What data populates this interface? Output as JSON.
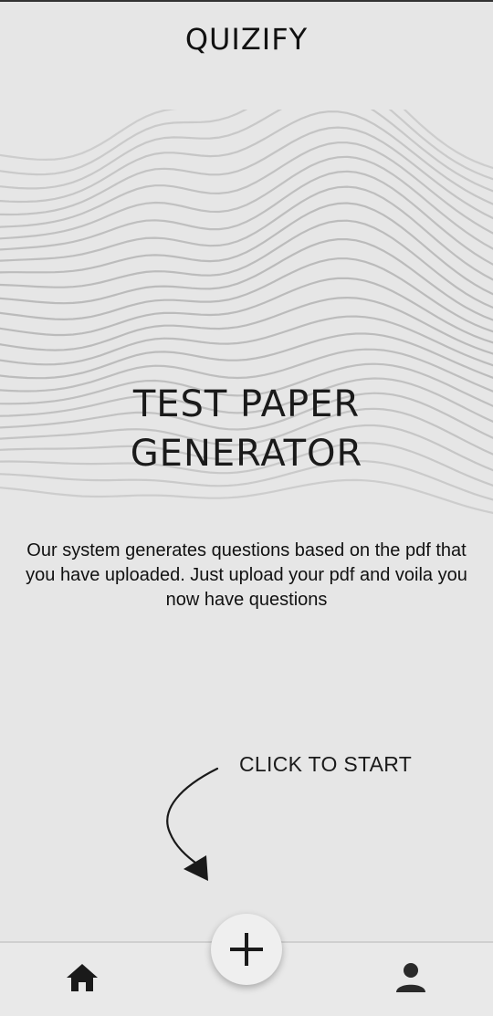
{
  "app": {
    "title": "QUIZIFY"
  },
  "hero": {
    "title_line1": "TEST PAPER",
    "title_line2": "GENERATOR",
    "description": "Our system generates questions based on the pdf that you have uploaded. Just upload your pdf and voila you now have questions"
  },
  "cta": {
    "hint": "CLICK TO START"
  },
  "icons": {
    "fab": "plus-icon",
    "home": "home-icon",
    "profile": "person-icon"
  },
  "colors": {
    "background": "#e6e6e6",
    "text": "#111111",
    "wave_lines": "#b8b8b8"
  }
}
